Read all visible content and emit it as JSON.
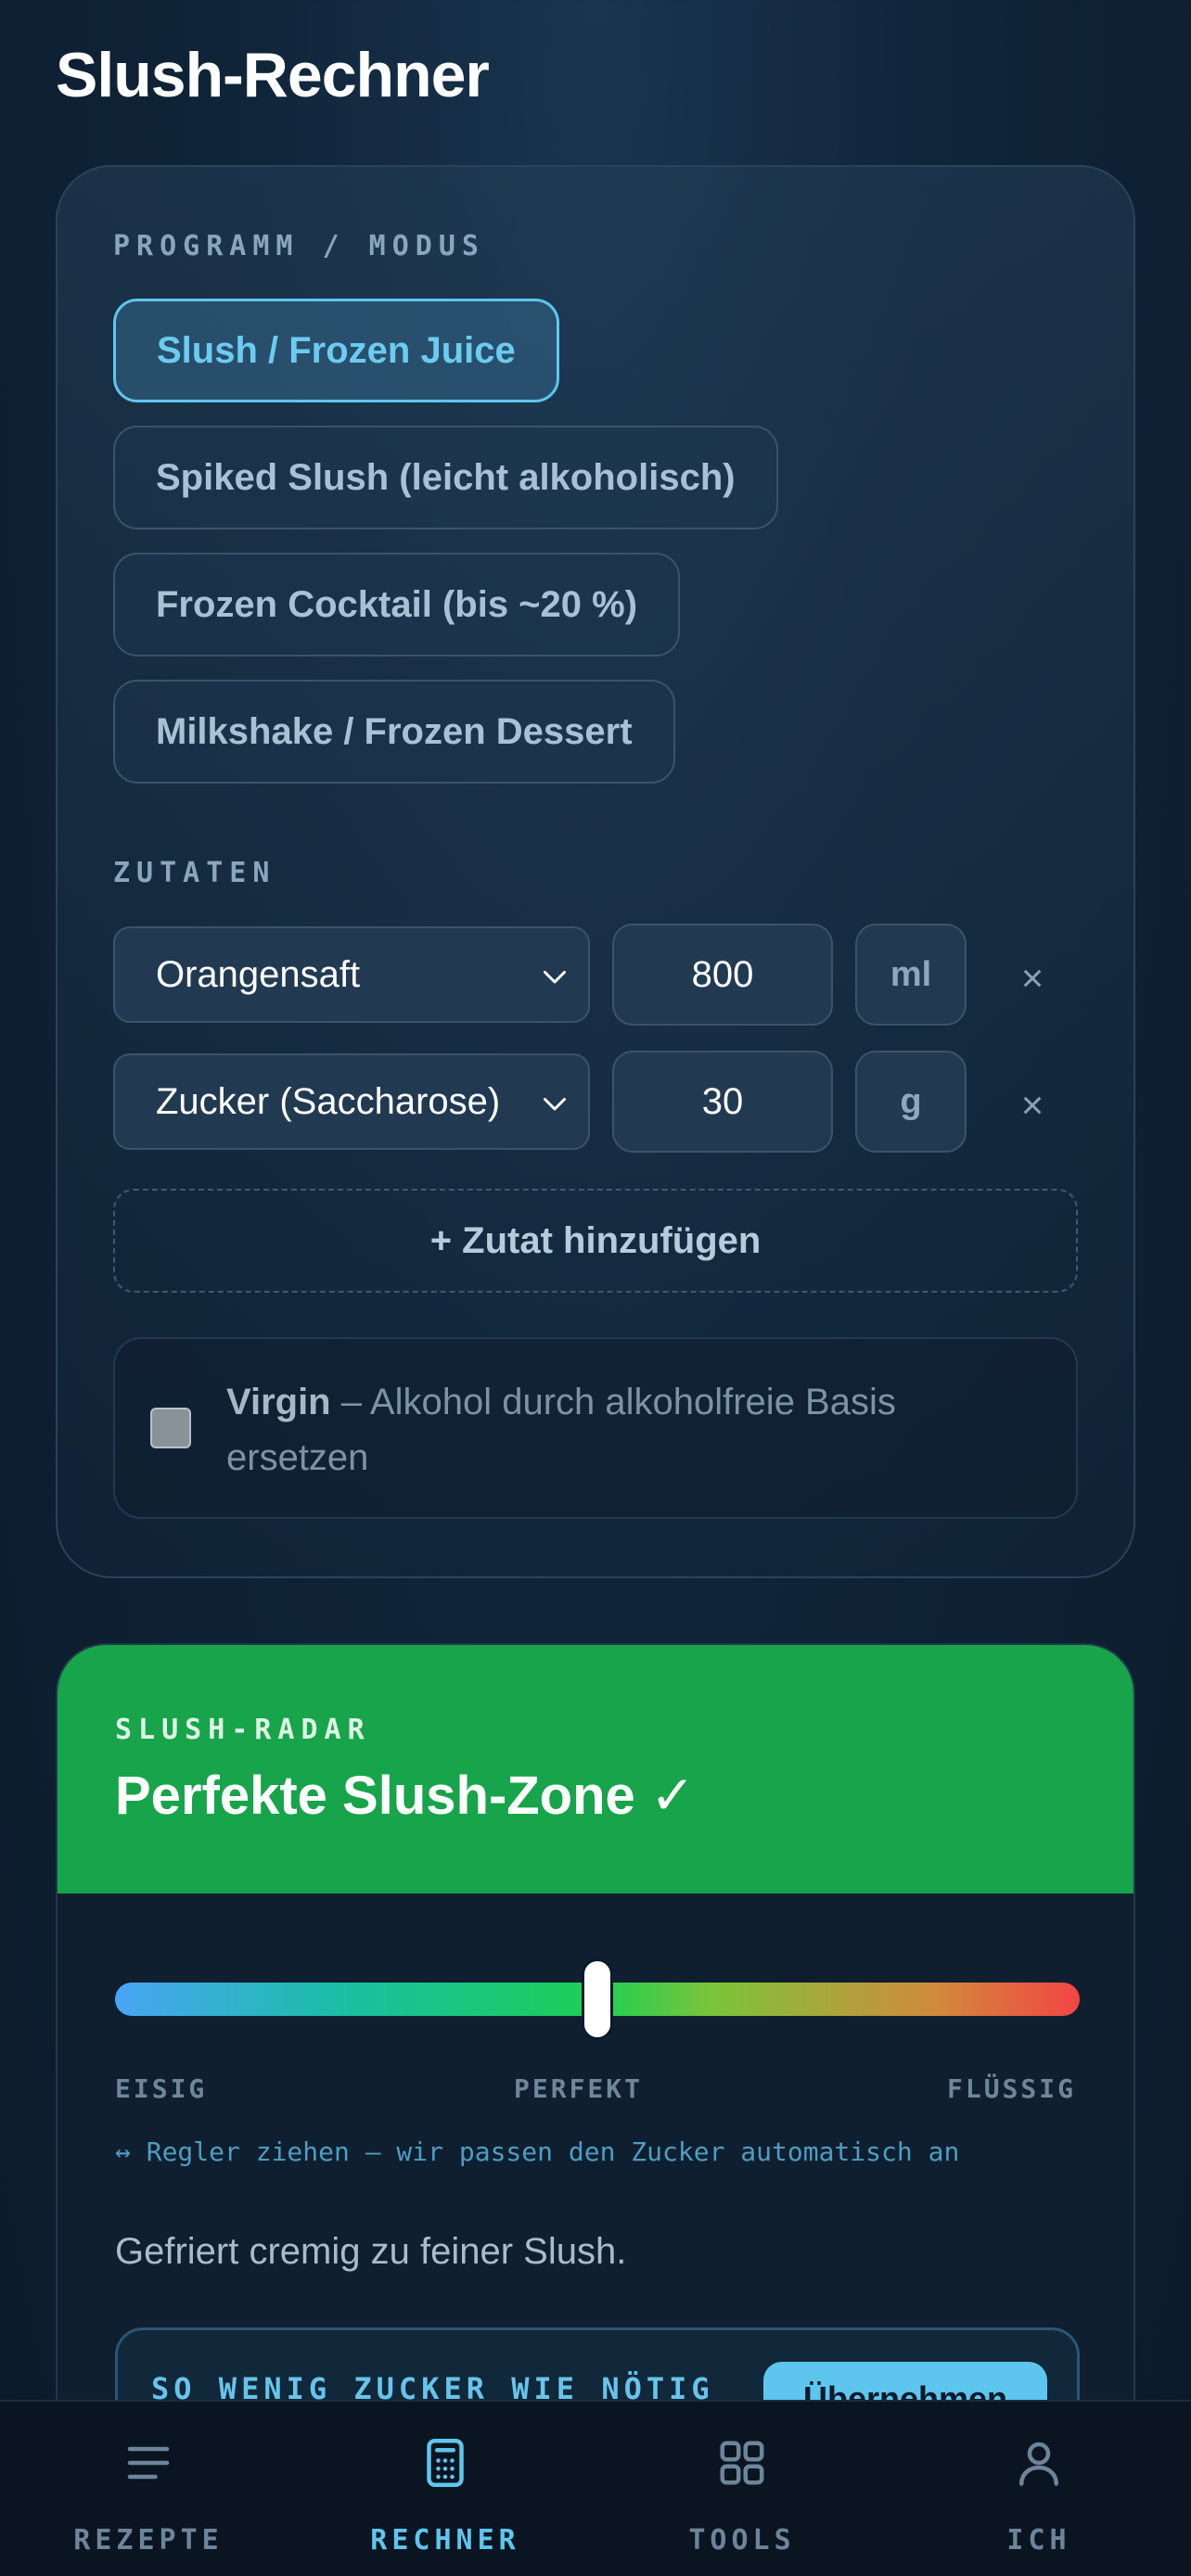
{
  "header": {
    "title": "Slush-Rechner"
  },
  "program": {
    "label": "PROGRAMM / MODUS",
    "modes": [
      {
        "label": "Slush / Frozen Juice",
        "active": true
      },
      {
        "label": "Spiked Slush (leicht alkoholisch)",
        "active": false
      },
      {
        "label": "Frozen Cocktail (bis ~20 %)",
        "active": false
      },
      {
        "label": "Milkshake / Frozen Dessert",
        "active": false
      }
    ]
  },
  "ingredients": {
    "label": "ZUTATEN",
    "items": [
      {
        "name": "Orangensaft",
        "amount": "800",
        "unit": "ml",
        "remove": "×"
      },
      {
        "name": "Zucker (Saccharose)",
        "amount": "30",
        "unit": "g",
        "remove": "×"
      }
    ],
    "add_label": "+ Zutat hinzufügen"
  },
  "virgin": {
    "strong": "Virgin",
    "rest": " – Alkohol durch alkoholfreie Basis ersetzen",
    "checked": false
  },
  "radar": {
    "label": "SLUSH-RADAR",
    "title": "Perfekte Slush-Zone ✓",
    "header_color": "#17a44a",
    "slider_value": 0.5,
    "scale": {
      "left": "EISIG",
      "center": "PERFEKT",
      "right": "FLÜSSIG"
    },
    "hint": "↔ Regler ziehen – wir passen den Zucker automatisch an",
    "description": "Gefriert cremig zu feiner Slush.",
    "sugar_label": "SO WENIG ZUCKER WIE NÖTIG",
    "apply_label": "Übernehmen"
  },
  "tabbar": {
    "tabs": [
      {
        "label": "REZEPTE",
        "icon": "menu-icon",
        "active": false
      },
      {
        "label": "RECHNER",
        "icon": "calculator-icon",
        "active": true
      },
      {
        "label": "TOOLS",
        "icon": "grid-icon",
        "active": false
      },
      {
        "label": "ICH",
        "icon": "user-icon",
        "active": false
      }
    ]
  },
  "colors": {
    "accent": "#5ec6ee",
    "success": "#17a44a",
    "background": "#0b1a2a"
  }
}
